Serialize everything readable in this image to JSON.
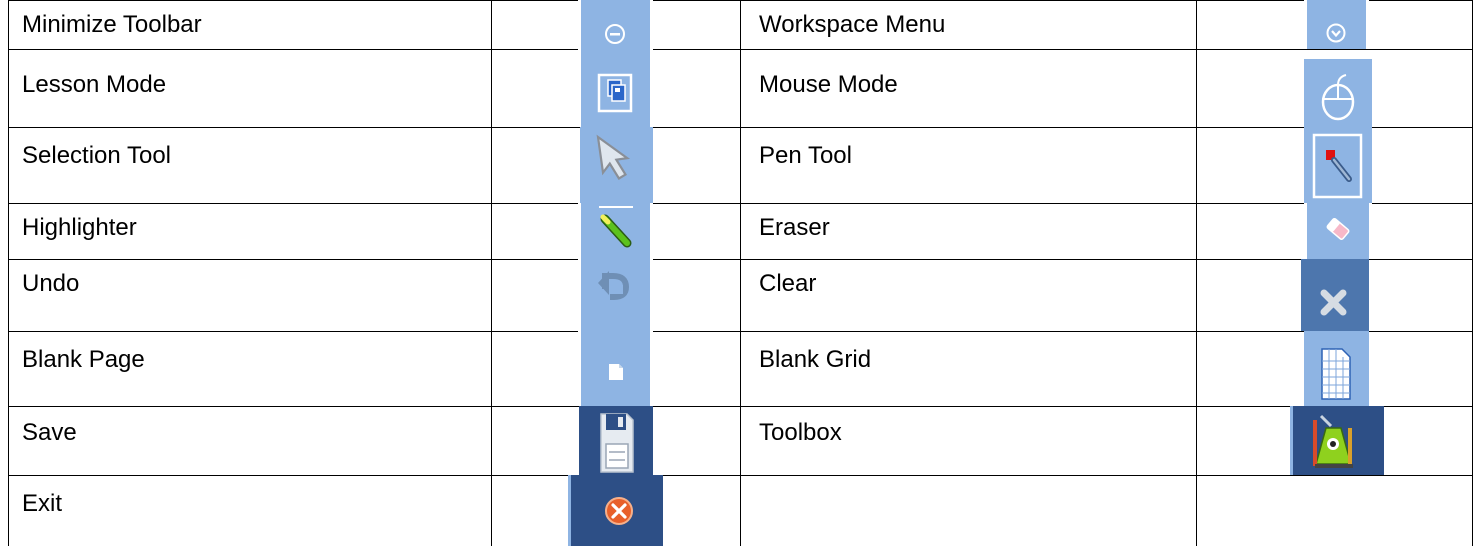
{
  "rows": [
    {
      "left": {
        "label": "Minimize Toolbar",
        "icon": "minimize-icon"
      },
      "right": {
        "label": "Workspace Menu",
        "icon": "chevron-down-circle-icon"
      }
    },
    {
      "left": {
        "label": "Lesson Mode",
        "icon": "lesson-pages-icon"
      },
      "right": {
        "label": "Mouse Mode",
        "icon": "mouse-icon"
      }
    },
    {
      "left": {
        "label": "Selection Tool",
        "icon": "arrow-cursor-icon"
      },
      "right": {
        "label": "Pen Tool",
        "icon": "pen-icon"
      }
    },
    {
      "left": {
        "label": "Highlighter",
        "icon": "highlighter-icon"
      },
      "right": {
        "label": "Eraser",
        "icon": "eraser-icon"
      }
    },
    {
      "left": {
        "label": "Undo",
        "icon": "undo-icon"
      },
      "right": {
        "label": "Clear",
        "icon": "close-x-icon"
      }
    },
    {
      "left": {
        "label": "Blank Page",
        "icon": "blank-page-icon"
      },
      "right": {
        "label": "Blank Grid",
        "icon": "grid-page-icon"
      }
    },
    {
      "left": {
        "label": "Save",
        "icon": "floppy-disk-icon"
      },
      "right": {
        "label": "Toolbox",
        "icon": "toolbox-icon"
      }
    },
    {
      "left": {
        "label": "Exit",
        "icon": "exit-icon"
      },
      "right": {
        "label": "",
        "icon": ""
      }
    }
  ],
  "colors": {
    "toolbar_light": "#8eb4e3",
    "toolbar_dark": "#2d4f86",
    "icon_white": "#ffffff",
    "exit_orange": "#e8602a",
    "highlighter_green": "#5cc21c",
    "pen_red": "#e01010",
    "toolbox_green": "#8fd11e"
  }
}
